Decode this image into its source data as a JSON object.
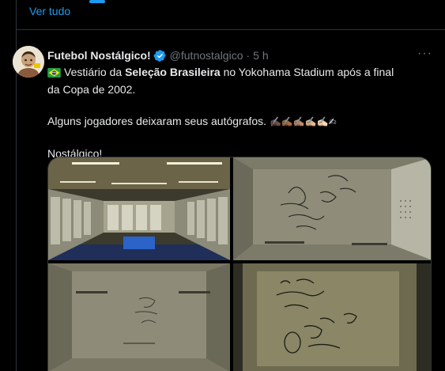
{
  "nav": {
    "ver_tudo": "Ver tudo"
  },
  "tweet": {
    "author_name": "Futebol Nostálgico!",
    "handle": "@futnostalgico",
    "separator": "·",
    "time": "5 h",
    "more_label": "···",
    "line1_part1": "Vestiário da ",
    "line1_bold": "Seleção Brasileira",
    "line1_part2": " no Yokohama Stadium após a final da Copa de 2002.",
    "line2": "Alguns jogadores deixaram seus autógrafos.",
    "line2_emojis": "✍🏿✍🏾✍🏽✍🏼✍🏻✍",
    "line3": "Nostálgico!"
  },
  "colors": {
    "accent": "#1d9bf0",
    "text": "#e7e9ea",
    "muted": "#71767b",
    "border": "#2f3336",
    "background": "#000000"
  },
  "icons": {
    "verified": "verified-badge-icon",
    "flag": "brazil-flag-icon",
    "more": "more-options-icon"
  }
}
